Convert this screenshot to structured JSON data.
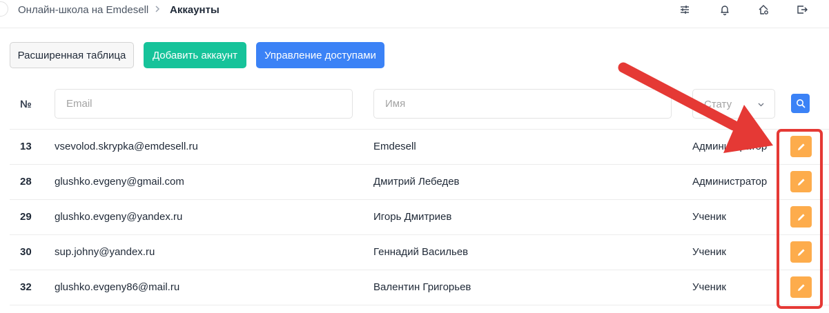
{
  "breadcrumb": {
    "home": "Онлайн-школа на Emdesell",
    "current": "Аккаунты"
  },
  "toolbar": {
    "extended_table": "Расширенная таблица",
    "add_account": "Добавить аккаунт",
    "access_management": "Управление доступами"
  },
  "filters": {
    "number_header": "№",
    "email_placeholder": "Email",
    "name_placeholder": "Имя",
    "status_placeholder": "Стату"
  },
  "accounts": [
    {
      "id": "13",
      "email": "vsevolod.skrypka@emdesell.ru",
      "name": "Emdesell",
      "role": "Администратор"
    },
    {
      "id": "28",
      "email": "glushko.evgeny@gmail.com",
      "name": "Дмитрий Лебедев",
      "role": "Администратор"
    },
    {
      "id": "29",
      "email": "glushko.evgeny@yandex.ru",
      "name": "Игорь Дмитриев",
      "role": "Ученик"
    },
    {
      "id": "30",
      "email": "sup.johny@yandex.ru",
      "name": "Геннадий Васильев",
      "role": "Ученик"
    },
    {
      "id": "32",
      "email": "glushko.evgeny86@mail.ru",
      "name": "Валентин Григорьев",
      "role": "Ученик"
    }
  ],
  "icons": {
    "topbar": [
      "sliders-icon",
      "bell-icon",
      "home-settings-icon",
      "logout-icon"
    ],
    "edit": "pencil-icon",
    "search": "search-icon"
  },
  "colors": {
    "green": "#16c39a",
    "blue": "#3b82f6",
    "edit_orange": "#fdac4c",
    "highlight_red": "#e53935"
  }
}
